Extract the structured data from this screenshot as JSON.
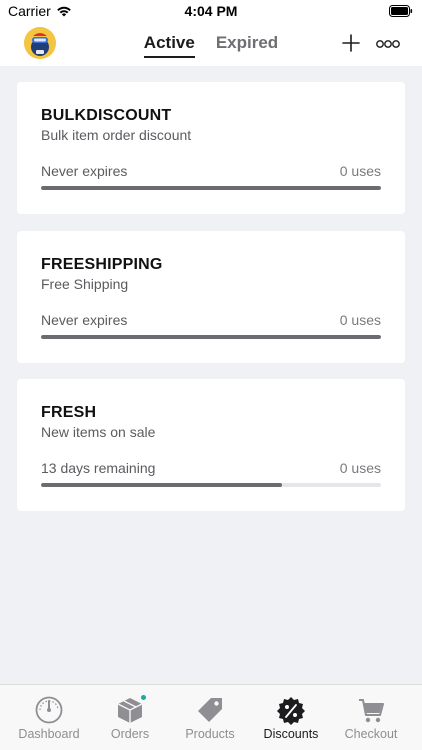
{
  "status_bar": {
    "carrier": "Carrier",
    "time": "4:04 PM",
    "wifi_icon": "wifi-icon",
    "battery_icon": "battery-icon"
  },
  "nav": {
    "tabs": [
      {
        "label": "Active",
        "selected": true
      },
      {
        "label": "Expired",
        "selected": false
      }
    ],
    "add_icon": "plus-icon",
    "more_icon": "more-icon",
    "avatar_icon": "avatar"
  },
  "discounts": [
    {
      "code": "BULKDISCOUNT",
      "description": "Bulk item order discount",
      "expiry": "Never expires",
      "uses": "0 uses",
      "progress": 1.0
    },
    {
      "code": "FREESHIPPING",
      "description": "Free Shipping",
      "expiry": "Never expires",
      "uses": "0 uses",
      "progress": 1.0
    },
    {
      "code": "FRESH",
      "description": "New items on sale",
      "expiry": "13 days remaining",
      "uses": "0 uses",
      "progress": 0.71
    }
  ],
  "tab_bar": {
    "items": [
      {
        "label": "Dashboard",
        "icon": "gauge-icon",
        "selected": false
      },
      {
        "label": "Orders",
        "icon": "box-icon",
        "selected": false,
        "badge_dot": true
      },
      {
        "label": "Products",
        "icon": "tag-icon",
        "selected": false
      },
      {
        "label": "Discounts",
        "icon": "percent-badge-icon",
        "selected": true
      },
      {
        "label": "Checkout",
        "icon": "cart-icon",
        "selected": false
      }
    ]
  },
  "colors": {
    "background": "#f0f1f5",
    "card": "#ffffff",
    "progress_fill": "#6b6b70",
    "progress_track": "#e5e5ea",
    "badge_dot": "#1aa9a0"
  }
}
